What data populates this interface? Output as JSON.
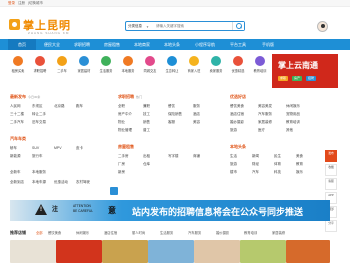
{
  "topbar": {
    "login": "登录",
    "register": "注册",
    "other": "|切换城市"
  },
  "header": {
    "logo": "掌上昆明",
    "logo_sub": "ZHANG SHANG KM"
  },
  "search": {
    "category": "分类信息",
    "placeholder": "请输入关键字搜索"
  },
  "nav": {
    "items": [
      "首页",
      "便民大全",
      "求职招聘",
      "房屋租售",
      "本地商家",
      "本地头条",
      "小程序导航",
      "平台工具",
      "手机版"
    ],
    "active_index": 0
  },
  "icons": {
    "items": [
      {
        "label": "租房买卖",
        "color": "#f07a23"
      },
      {
        "label": "求职招聘",
        "color": "#e9513a"
      },
      {
        "label": "二手车",
        "color": "#f3a117"
      },
      {
        "label": "家居建材",
        "color": "#2a8fd6"
      },
      {
        "label": "生活服务",
        "color": "#3fb15b"
      },
      {
        "label": "本地服务",
        "color": "#f07a23"
      },
      {
        "label": "同城交友",
        "color": "#e24a8b"
      },
      {
        "label": "生意转让",
        "color": "#1e8fd6"
      },
      {
        "label": "商家入驻",
        "color": "#f5b31e"
      },
      {
        "label": "卖家服务",
        "color": "#2fb3a8"
      },
      {
        "label": "优惠精选",
        "color": "#e9513a"
      },
      {
        "label": "教育培训",
        "color": "#7c5bd6"
      }
    ]
  },
  "banner": {
    "title": "掌上云南通",
    "pills": [
      "求职",
      "房产",
      "招聘"
    ]
  },
  "col1": {
    "title": "最新发布",
    "subtitle": "今日30条",
    "row1": [
      "人民网",
      "东坝区",
      "北京路",
      "跑车"
    ],
    "row2": [
      "三十二楼",
      "转让二手",
      ""
    ],
    "row3": [
      "二手汽车",
      "旧车交易",
      ""
    ],
    "subhead": "汽车车类",
    "row4": [
      "轿车",
      "SUV",
      "MPV",
      "皮卡"
    ],
    "row5": [
      "新能源",
      "旅行车",
      "",
      ""
    ],
    "row6": [
      "全新车",
      "本地服务",
      "",
      ""
    ],
    "row7": [
      "全新到店",
      "本地车源",
      "优惠活动",
      "农村驾驶"
    ]
  },
  "col2": {
    "title": "求职招聘",
    "subtitle": "热门",
    "row1": [
      "全职",
      "兼职",
      "餐饮",
      "服务"
    ],
    "row2": [
      "房产中介",
      "技工",
      "保险销售",
      "酒店"
    ],
    "row3": [
      "物业",
      "销售",
      "客服",
      "美容"
    ],
    "row4": [
      "物业管理",
      "普工",
      "",
      ""
    ],
    "subhead": "房屋租售",
    "row5": [
      "二手房",
      "出租",
      "写字楼",
      "商铺"
    ],
    "row6": [
      "厂房",
      "仓库",
      "",
      ""
    ],
    "row7": [
      "新房",
      "",
      "",
      ""
    ]
  },
  "col3": {
    "title": "优选好店",
    "subtitle": "",
    "row1": [
      "餐饮美食",
      "美容美发",
      "休闲娱乐"
    ],
    "row2": [
      "酒店住宿",
      "汽车服务",
      "宠物用品"
    ],
    "row3": [
      "婚纱摄影",
      "家居装修",
      "教育培训"
    ],
    "row4": [
      "旅游",
      "医疗",
      "其他"
    ],
    "subhead": "本地头条",
    "row5": [
      "生活",
      "新闻",
      "民生",
      "美食"
    ],
    "row6": [
      "旅游",
      "财经",
      "体育",
      "教育"
    ],
    "row7": [
      "楼市",
      "汽车",
      "科技",
      "娱乐"
    ]
  },
  "sidebar": {
    "items": [
      "发布",
      "收藏",
      "客服",
      "APP",
      "顶部",
      "分享"
    ]
  },
  "notice": {
    "mark": "!",
    "att1": "注",
    "att2": "ATTENTION",
    "att3": "BE CAREFUL",
    "att4": "意",
    "message": "站内发布的招聘信息将会在公众号同步推送"
  },
  "bottom": {
    "title": "推荐店铺",
    "tabs": [
      "全部",
      "餐饮美食",
      "休闲娱乐",
      "酒店住宿",
      "丽人时尚",
      "生活服务",
      "汽车服务",
      "婚纱摄影",
      "教育培训",
      "家居装修"
    ],
    "thumb_colors": [
      "#e8e2d6",
      "#d2341c",
      "#c9a24e",
      "#7fb3d8",
      "#e0c6a8",
      "#b6c96d",
      "#d66a2b"
    ]
  }
}
